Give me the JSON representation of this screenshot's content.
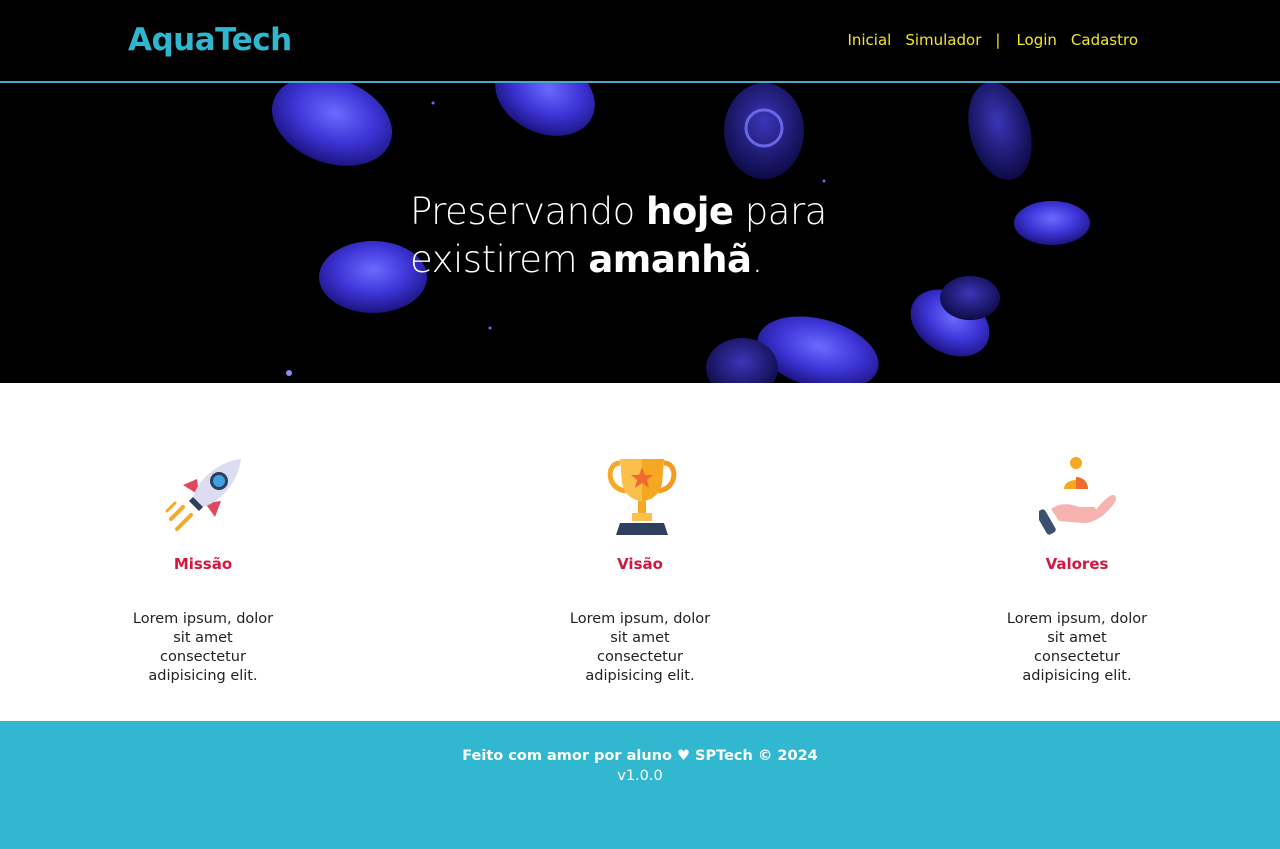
{
  "header": {
    "logo": "AquaTech",
    "nav": {
      "inicial": "Inicial",
      "simulador": "Simulador",
      "separator": "|",
      "login": "Login",
      "cadastro": "Cadastro"
    }
  },
  "hero": {
    "line1_pre": "Preservando ",
    "line1_bold": "hoje",
    "line1_post": " para",
    "line2_pre": "existirem ",
    "line2_bold": "amanhã",
    "line2_post": "."
  },
  "features": [
    {
      "icon": "rocket-icon",
      "title": "Missão",
      "description": "Lorem ipsum, dolor sit amet consectetur adipisicing elit."
    },
    {
      "icon": "trophy-icon",
      "title": "Visão",
      "description": "Lorem ipsum, dolor sit amet consectetur adipisicing elit."
    },
    {
      "icon": "hand-person-icon",
      "title": "Valores",
      "description": "Lorem ipsum, dolor sit amet consectetur adipisicing elit."
    }
  ],
  "footer": {
    "credit": "Feito com amor por aluno ♥ SPTech © 2024",
    "version": "v1.0.0"
  },
  "colors": {
    "logo": "#2fb7cf",
    "nav_link": "#f2e62b",
    "feature_title": "#d4173f",
    "footer_bg": "#31b7cf",
    "header_bg": "#000000"
  }
}
